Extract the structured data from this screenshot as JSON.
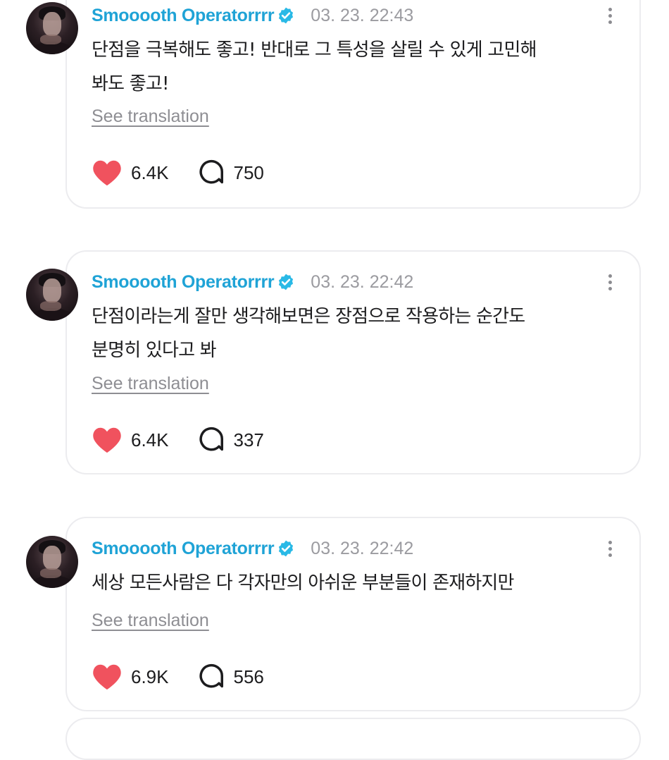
{
  "colors": {
    "name": "#1fa3d6",
    "verified_badge": "#29b9e6",
    "heart": "#f0525e",
    "timestamp": "#9b9ba0",
    "card_border": "#ececef"
  },
  "posts": [
    {
      "author": "Smooooth Operatorrrr",
      "verified_icon": "verified-badge-icon",
      "timestamp": "03. 23. 22:43",
      "text_line1": "단점을 극복해도 좋고! 반대로 그 특성을 살릴 수 있게 고민해",
      "text_line2": "봐도 좋고!",
      "translate_label": "See translation",
      "likes": "6.4K",
      "comments": "750"
    },
    {
      "author": "Smooooth Operatorrrr",
      "verified_icon": "verified-badge-icon",
      "timestamp": "03. 23. 22:42",
      "text_line1": "단점이라는게 잘만 생각해보면은 장점으로 작용하는 순간도",
      "text_line2": "분명히 있다고 봐",
      "translate_label": "See translation",
      "likes": "6.4K",
      "comments": "337"
    },
    {
      "author": "Smooooth Operatorrrr",
      "verified_icon": "verified-badge-icon",
      "timestamp": "03. 23. 22:42",
      "text_line1": "세상 모든사람은 다 각자만의 아쉬운 부분들이 존재하지만",
      "text_line2": "",
      "translate_label": "See translation",
      "likes": "6.9K",
      "comments": "556"
    }
  ]
}
